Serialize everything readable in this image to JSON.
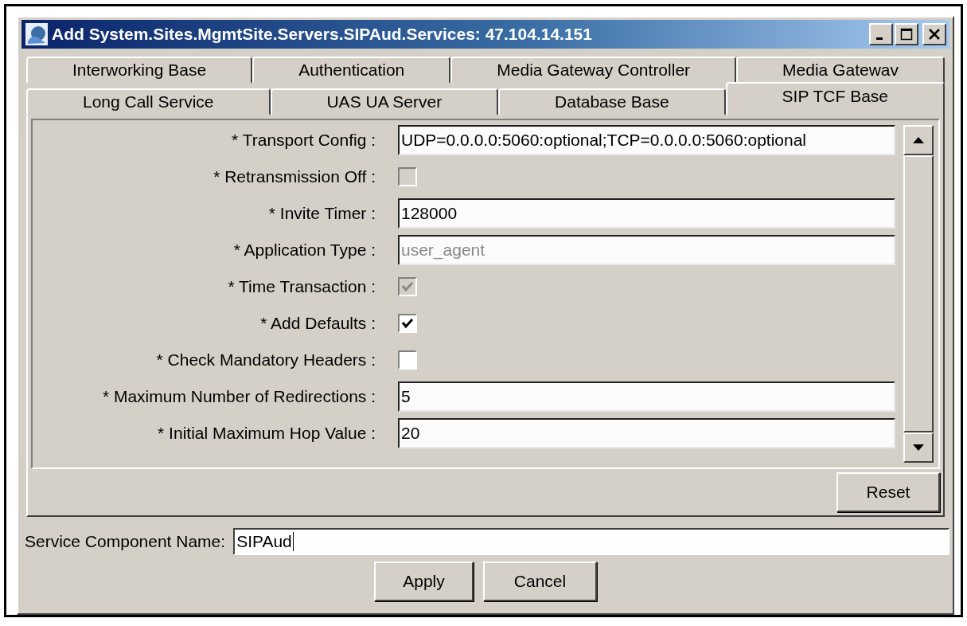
{
  "window": {
    "title": "Add System.Sites.MgmtSite.Servers.SIPAud.Services: 47.104.14.151"
  },
  "tab_rows": [
    [
      {
        "label": "Interworking Base",
        "selected": false
      },
      {
        "label": "Authentication",
        "selected": false
      },
      {
        "label": "Media Gateway Controller",
        "selected": false
      },
      {
        "label": "Media Gatewav",
        "selected": false
      }
    ],
    [
      {
        "label": "Long Call Service",
        "selected": false
      },
      {
        "label": "UAS UA Server",
        "selected": false
      },
      {
        "label": "Database Base",
        "selected": false
      },
      {
        "label": "SIP TCF Base",
        "selected": true
      }
    ]
  ],
  "fields": [
    {
      "kind": "text",
      "label": "* Transport Config :",
      "value": "UDP=0.0.0.0:5060:optional;TCP=0.0.0.0:5060:optional",
      "disabled": false
    },
    {
      "kind": "checkbox",
      "label": "* Retransmission Off :",
      "checked": false,
      "disabled": true
    },
    {
      "kind": "text",
      "label": "* Invite Timer :",
      "value": "128000",
      "disabled": false
    },
    {
      "kind": "text",
      "label": "* Application Type :",
      "value": "user_agent",
      "disabled": true
    },
    {
      "kind": "checkbox",
      "label": "* Time Transaction :",
      "checked": true,
      "disabled": true
    },
    {
      "kind": "checkbox",
      "label": "* Add Defaults :",
      "checked": true,
      "disabled": false
    },
    {
      "kind": "checkbox",
      "label": "* Check Mandatory Headers :",
      "checked": false,
      "disabled": false
    },
    {
      "kind": "text",
      "label": "* Maximum Number of Redirections :",
      "value": "5",
      "disabled": false
    },
    {
      "kind": "text",
      "label": "* Initial Maximum Hop Value :",
      "value": "20",
      "disabled": false
    }
  ],
  "reset_button": "Reset",
  "service_component": {
    "label": "Service Component Name:",
    "value": "SIPAud"
  },
  "buttons": [
    "Apply",
    "Cancel"
  ]
}
